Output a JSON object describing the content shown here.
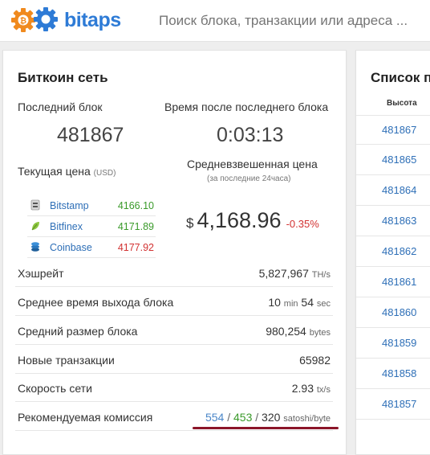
{
  "header": {
    "logo_text": "bitaps",
    "search_placeholder": "Поиск блока, транзакции или адреса ..."
  },
  "network": {
    "title": "Биткоин сеть",
    "last_block_label": "Последний блок",
    "last_block_value": "481867",
    "time_since_label": "Время после последнего блока",
    "time_since_value": "0:03:13",
    "current_price_label": "Текущая цена",
    "current_price_unit": "(USD)",
    "exchanges": [
      {
        "name": "Bitstamp",
        "price": "4166.10",
        "color": "#3a9a2a",
        "icon": "bitstamp-icon"
      },
      {
        "name": "Bitfinex",
        "price": "4171.89",
        "color": "#3a9a2a",
        "icon": "bitfinex-leaf-icon"
      },
      {
        "name": "Coinbase",
        "price": "4177.92",
        "color": "#d23232",
        "icon": "coinbase-coins-icon"
      }
    ],
    "weighted_price_label": "Средневзвешенная цена",
    "weighted_price_sub": "(за последние 24часа)",
    "weighted_price_currency": "$",
    "weighted_price_value": "4,168.96",
    "weighted_price_change": "-0.35%",
    "stats": {
      "hashrate_label": "Хэшрейт",
      "hashrate_value": "5,827,967",
      "hashrate_unit": "TH/s",
      "block_time_label": "Среднее время выхода блока",
      "block_time_min": "10",
      "block_time_min_unit": "min",
      "block_time_sec": "54",
      "block_time_sec_unit": "sec",
      "block_size_label": "Средний размер блока",
      "block_size_value": "980,254",
      "block_size_unit": "bytes",
      "new_tx_label": "Новые транзакции",
      "new_tx_value": "65982",
      "speed_label": "Скорость сети",
      "speed_value": "2.93",
      "speed_unit": "tx/s",
      "fee_label": "Рекомендуемая комиссия",
      "fee_high": "554",
      "fee_mid": "453",
      "fee_low": "320",
      "fee_sep": "/",
      "fee_unit": "satoshi/byte"
    }
  },
  "blocks": {
    "title": "Список п",
    "column_header": "Высота",
    "items": [
      "481867",
      "481865",
      "481864",
      "481863",
      "481862",
      "481861",
      "481860",
      "481859",
      "481858",
      "481857"
    ]
  },
  "colors": {
    "link": "#2e6fb7",
    "up": "#3a9a2a",
    "down": "#d23232",
    "fee_high": "#4a86c8",
    "fee_mid": "#3a9a2a",
    "underline": "#8c1529"
  }
}
